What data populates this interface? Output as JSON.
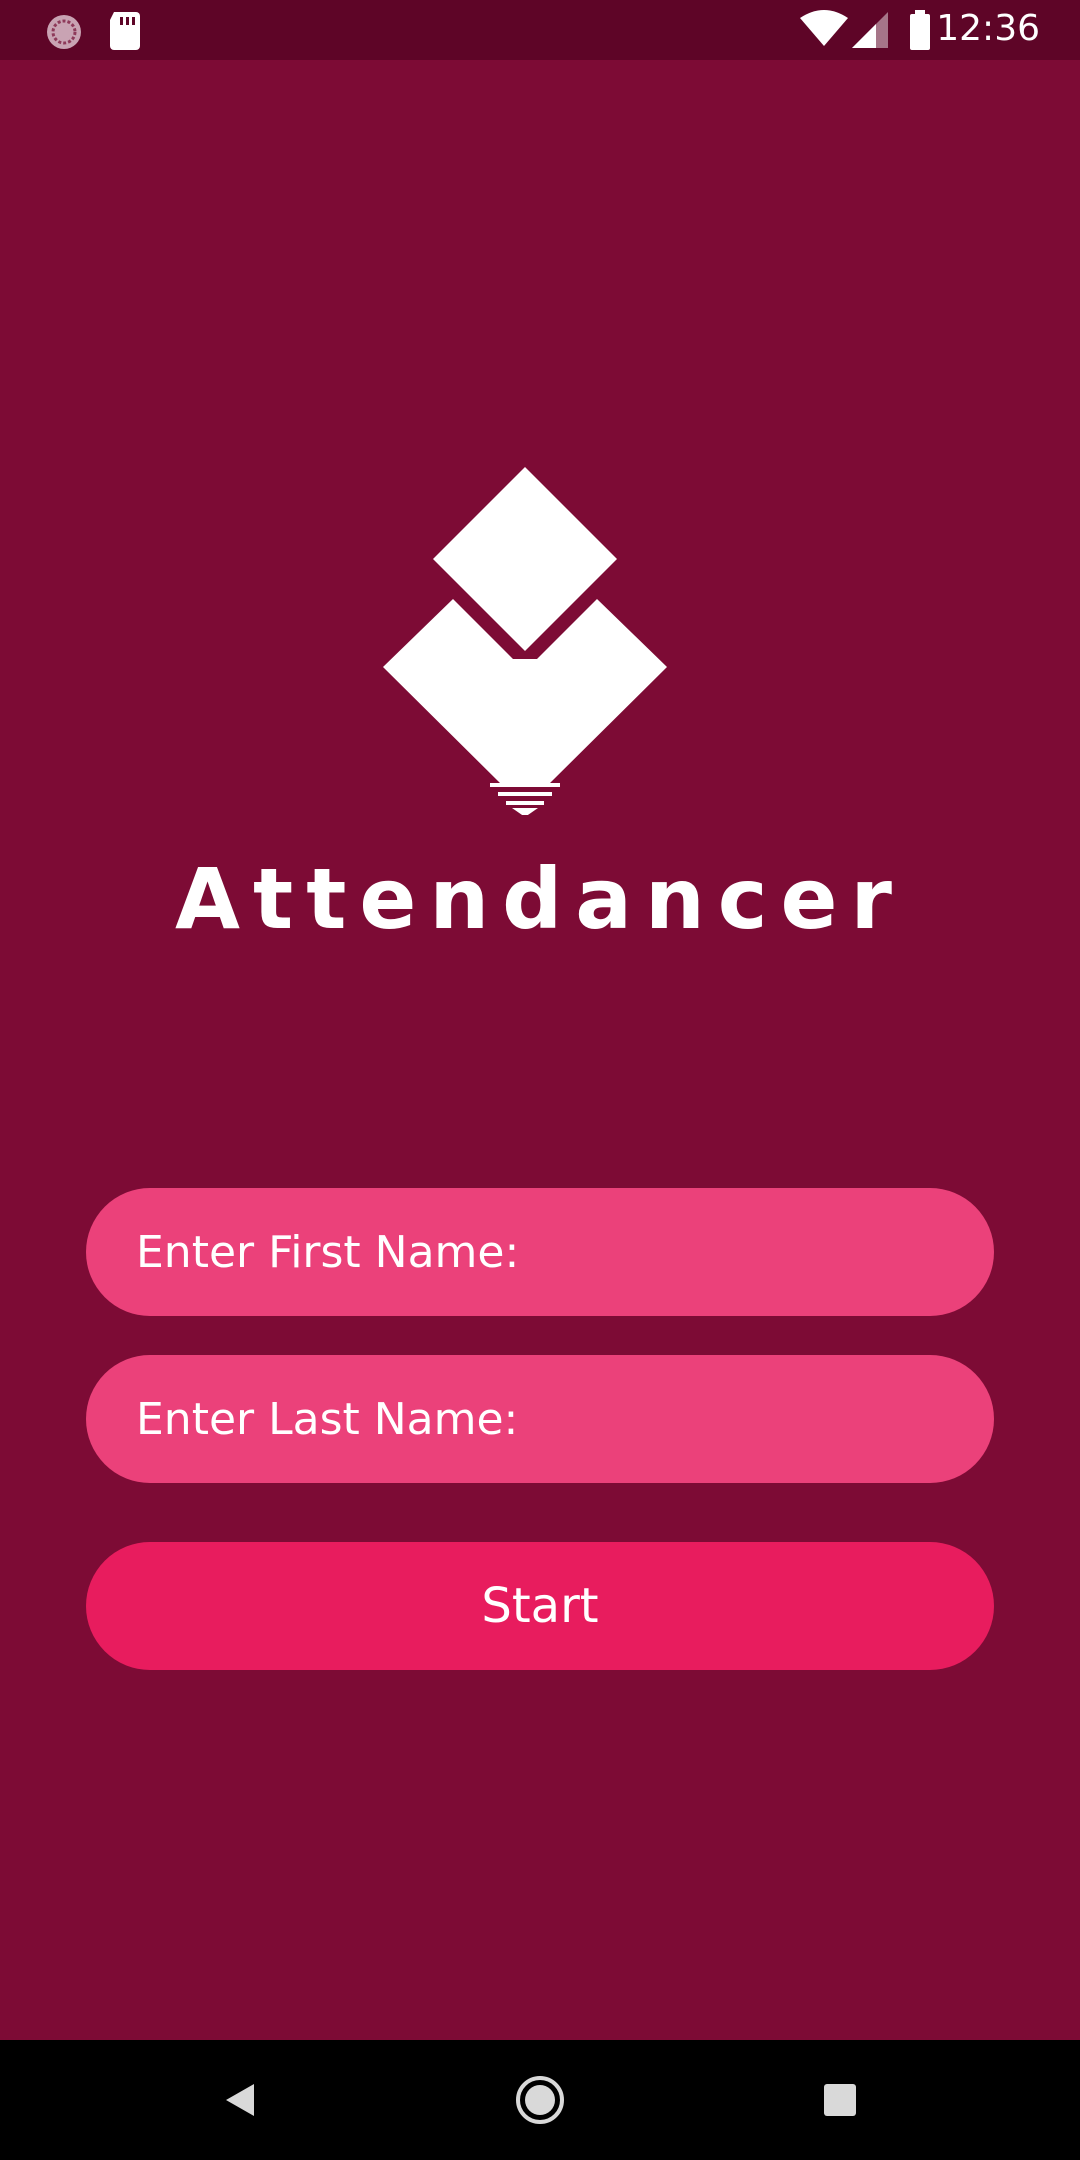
{
  "status_bar": {
    "time": "12:36",
    "left_icons": [
      "loading-circle-icon",
      "sd-card-icon"
    ],
    "right_icons": [
      "wifi-icon",
      "signal-icon",
      "battery-icon"
    ]
  },
  "app": {
    "title": "Attendancer",
    "logo_icon": "attendancer-logo-icon"
  },
  "form": {
    "first_name_placeholder": "Enter First Name:",
    "first_name_value": "",
    "last_name_placeholder": "Enter Last Name:",
    "last_name_value": "",
    "start_label": "Start"
  },
  "nav_bar": {
    "buttons": [
      "back-icon",
      "home-icon",
      "recents-icon"
    ]
  },
  "colors": {
    "background": "#7d0b35",
    "status_bar": "#5e0527",
    "field": "#eb417a",
    "button": "#e81c5e"
  }
}
